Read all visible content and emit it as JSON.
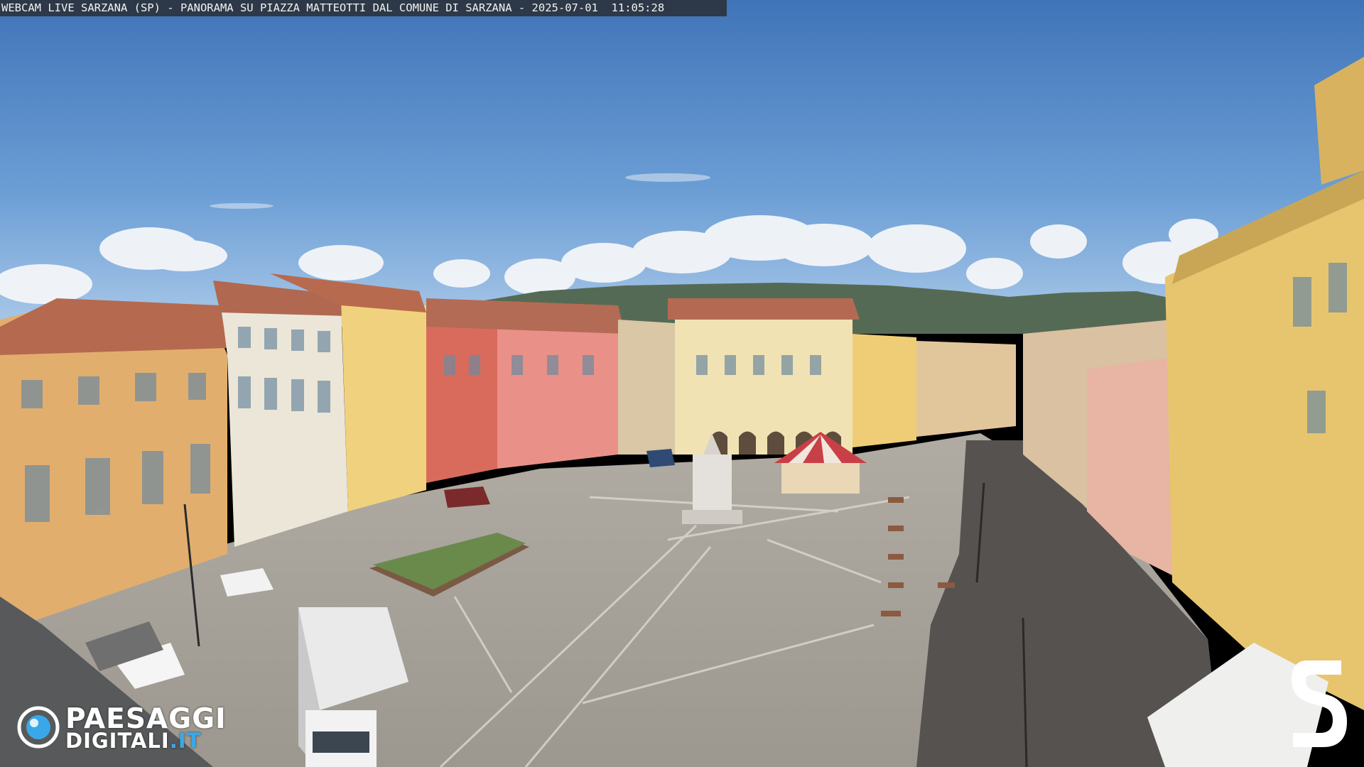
{
  "overlay": {
    "caption": "WEBCAM LIVE SARZANA (SP) - PANORAMA SU PIAZZA MATTEOTTI DAL COMUNE DI SARZANA - 2025-07-01  11:05:28"
  },
  "logos": {
    "paesaggi_top": "PAESAGGI",
    "paesaggi_bottom": "DIGITALI",
    "paesaggi_tld": ".IT",
    "corner_mark": "S",
    "accent_color": "#3aa8e8",
    "icon": "camera-lens-icon"
  },
  "scene": {
    "sky_color": "#4f86c6",
    "pavement_color": "#a8a39b",
    "shadow_color": "#4a4744"
  }
}
